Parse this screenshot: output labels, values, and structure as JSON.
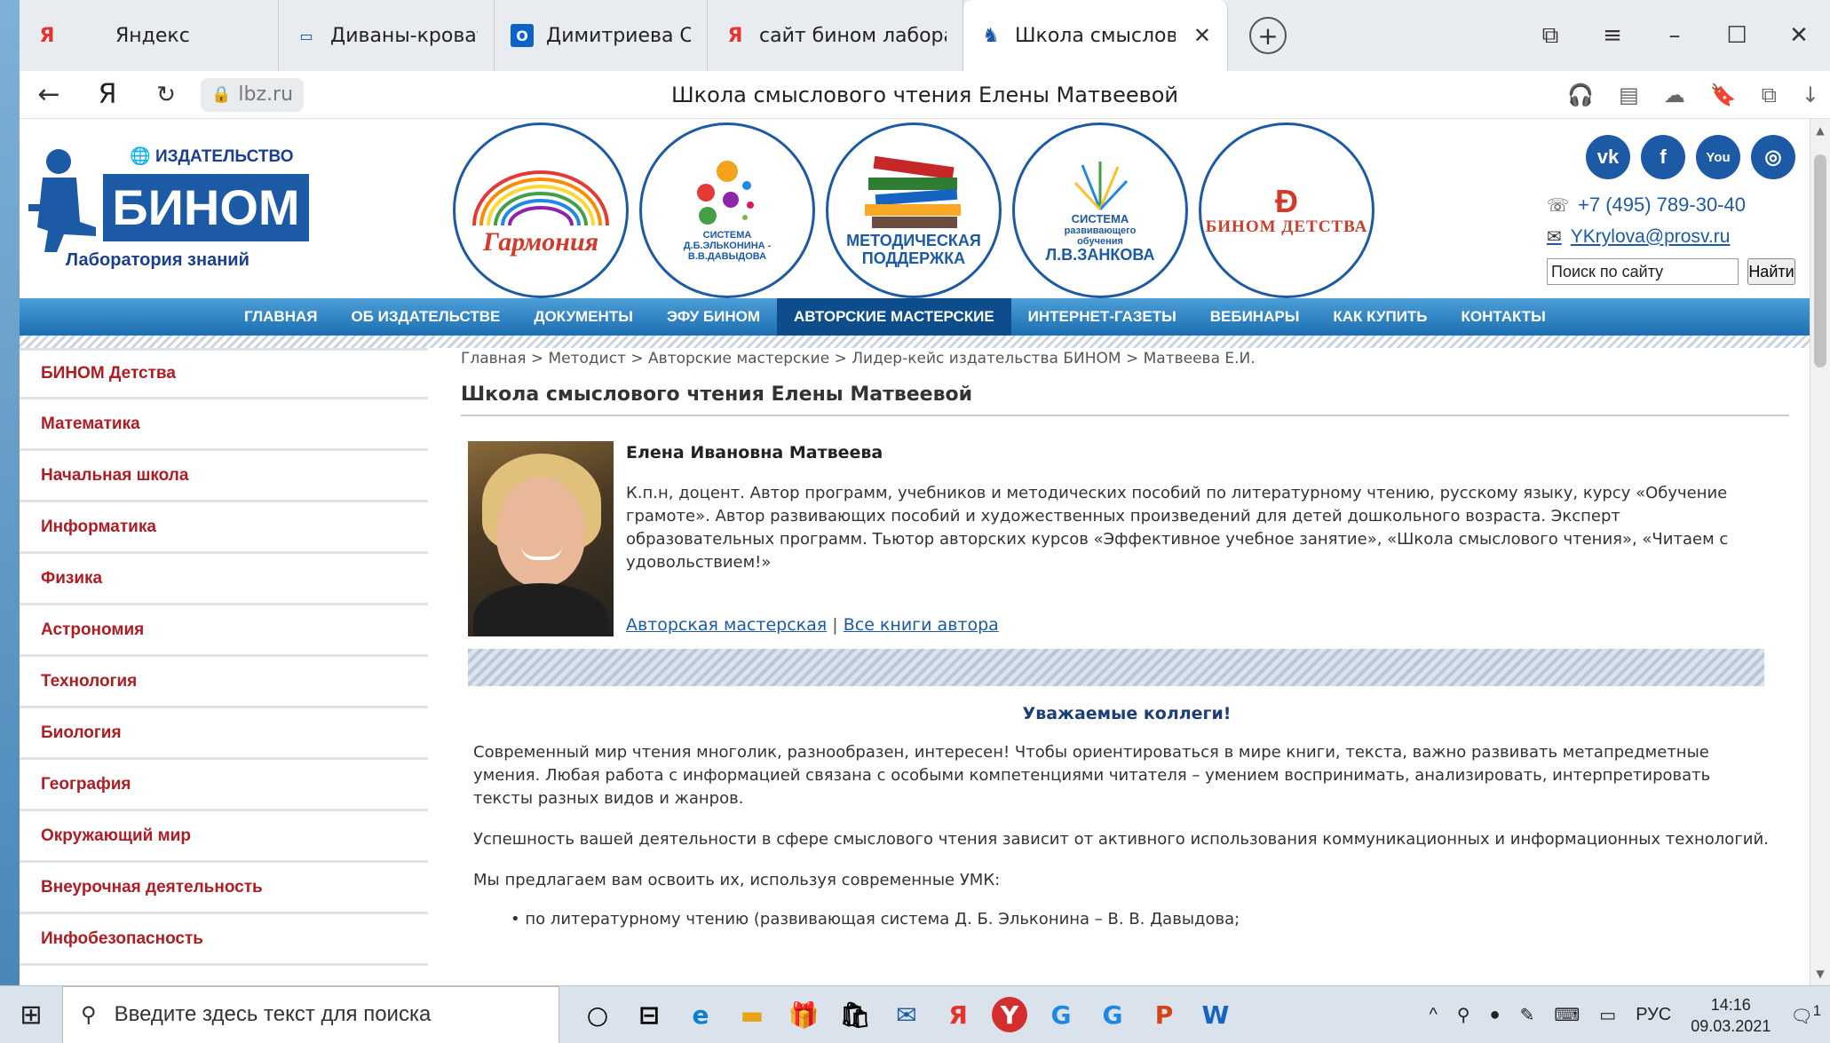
{
  "browser": {
    "tabs": [
      {
        "icon": "Я",
        "title": "Яндекс",
        "icon_color": "#e5322d"
      },
      {
        "icon": "▭",
        "title": "Диваны-кровати и кресл",
        "icon_color": "#0b57a4"
      },
      {
        "icon": "O",
        "title": "Димитриева Светлана В",
        "icon_color": "#0a64c8"
      },
      {
        "icon": "Я",
        "title": "сайт бином лаборатори",
        "icon_color": "#e5322d"
      },
      {
        "icon": "♞",
        "title": "Школа смыслового ч",
        "icon_color": "#1c5aa6",
        "close": "✕"
      }
    ],
    "new_tab": "+",
    "window_controls": [
      "⧉",
      "≡",
      "–",
      "☐",
      "✕"
    ],
    "nav": {
      "back": "←",
      "yandex": "Я",
      "reload": "↻"
    },
    "url": "lbz.ru",
    "lock": "🔒",
    "page_title": "Школа смыслового чтения Елены Матвеевой",
    "tools": [
      "🎧",
      "▤",
      "☁",
      "🔖",
      "⧉",
      "↓"
    ]
  },
  "site": {
    "logo": {
      "publisher": "ИЗДАТЕЛЬСТВО",
      "name": "БИНОМ",
      "subtitle": "Лаборатория знаний"
    },
    "circles": [
      {
        "label": "Гармония"
      },
      {
        "small": "СИСТЕМА",
        "small2": "Д.Б.ЭЛЬКОНИНА -",
        "small3": "В.В.ДАВЫДОВА"
      },
      {
        "big": "МЕТОДИЧЕСКАЯ",
        "big2": "ПОДДЕРЖКА"
      },
      {
        "small": "СИСТЕМА",
        "small2": "развивающего",
        "small3": "обучения",
        "big": "Л.В.ЗАНКОВА"
      },
      {
        "label": "БИНОМ ДЕТСТВА"
      }
    ],
    "social": [
      "vk",
      "f",
      "You",
      "◎"
    ],
    "phone": "+7 (495) 789-30-40",
    "email": "YKrylova@prosv.ru",
    "search_placeholder": "Поиск по сайту",
    "search_button": "Найти",
    "topnav": [
      "ГЛАВНАЯ",
      "ОБ ИЗДАТЕЛЬСТВЕ",
      "ДОКУМЕНТЫ",
      "ЭФУ БИНОМ",
      "АВТОРСКИЕ МАСТЕРСКИЕ",
      "ИНТЕРНЕТ-ГАЗЕТЫ",
      "ВЕБИНАРЫ",
      "КАК КУПИТЬ",
      "КОНТАКТЫ"
    ],
    "active_nav": "АВТОРСКИЕ МАСТЕРСКИЕ",
    "sidebar": [
      "БИНОМ Детства",
      "Математика",
      "Начальная школа",
      "Информатика",
      "Физика",
      "Астрономия",
      "Технология",
      "Биология",
      "География",
      "Окружающий мир",
      "Внеурочная деятельность",
      "Инфобезопасность"
    ],
    "breadcrumbs": [
      "Главная",
      "Методист",
      "Авторские мастерские",
      "Лидер-кейс издательства БИНОМ",
      "Матвеева Е.И."
    ],
    "crumb_sep": " > ",
    "heading": "Школа смыслового чтения Елены Матвеевой",
    "author": {
      "name": "Елена Ивановна Матвеева",
      "bio": "К.п.н, доцент. Автор программ, учебников и методических пособий по литературному чтению, русскому языку, курсу «Обучение грамоте». Автор развивающих пособий и художественных произведений для детей дошкольного возраста. Эксперт образовательных программ. Тьютор авторских курсов «Эффективное учебное занятие», «Школа смыслового чтения», «Читаем с удовольствием!»",
      "link1": "Авторская мастерская",
      "link_sep": "|",
      "link2": "Все книги автора"
    },
    "greeting": "Уважаемые коллеги!",
    "paragraphs": [
      "Современный мир чтения многолик, разнообразен, интересен! Чтобы ориентироваться в мире книги, текста, важно развивать метапредметные умения. Любая работа с информацией связана с особыми компетенциями читателя – умением воспринимать, анализировать, интерпретировать тексты разных видов и жанров.",
      "Успешность вашей деятельности в сфере смыслового чтения зависит от активного использования коммуникационных и информационных технологий.",
      "Мы предлагаем вам освоить их, используя современные УМК:"
    ],
    "bullet_partial": "• по литературному чтению (развивающая система Д. Б. Эльконина – В. В. Давыдова;"
  },
  "taskbar": {
    "start": "⊞",
    "search_icon": "⚲",
    "search_placeholder": "Введите здесь текст для поиска",
    "apps": [
      "○",
      "⊟",
      "e",
      "▬",
      "🎁",
      "🛍",
      "✉",
      "Я",
      "Y",
      "G",
      "G",
      "P",
      "W"
    ],
    "tray": [
      "^",
      "⚲",
      "●",
      "✎",
      "⌨",
      "▭"
    ],
    "lang": "РУС",
    "time": "14:16",
    "date": "09.03.2021",
    "notif": "1"
  }
}
